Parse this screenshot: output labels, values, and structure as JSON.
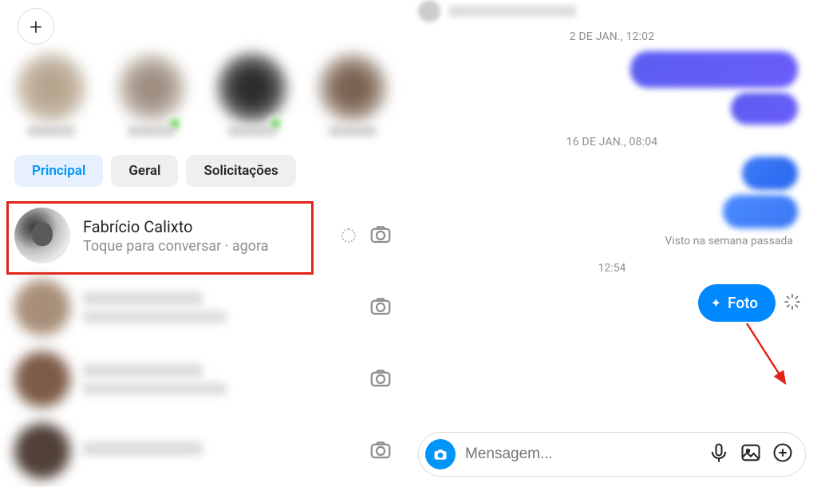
{
  "tabs": {
    "principal": "Principal",
    "geral": "Geral",
    "solicitacoes": "Solicitações"
  },
  "chat": {
    "name": "Fabrício Calixto",
    "subtitle": "Toque para conversar · agora"
  },
  "timestamps": {
    "t1": "2 DE JAN., 12:02",
    "t2": "16 DE JAN., 08:04",
    "t3": "12:54"
  },
  "seen_text": "Visto na semana passada",
  "foto_label": "Foto",
  "input": {
    "placeholder": "Mensagem..."
  }
}
